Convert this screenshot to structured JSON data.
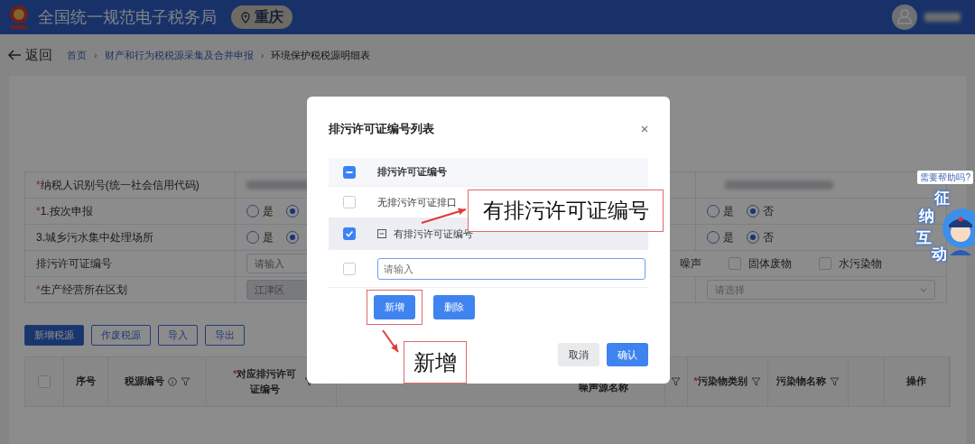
{
  "header": {
    "title": "全国统一规范电子税务局",
    "location": "重庆"
  },
  "required_mark": "*",
  "breadcrumb": {
    "back": "返回",
    "separator": "›",
    "items": [
      {
        "label": "首页",
        "current": false
      },
      {
        "label": "财产和行为税税源采集及合并申报",
        "current": false
      },
      {
        "label": "环境保护税税源明细表",
        "current": true
      }
    ]
  },
  "form": {
    "rows": [
      {
        "label": "纳税人识别号(统一社会信用代码)",
        "required": true,
        "left": {
          "kind": "redacted"
        },
        "right": {
          "kind": "redacted"
        }
      },
      {
        "label": "1.按次申报",
        "required": true,
        "left": {
          "kind": "radio",
          "options": [
            {
              "label": "是",
              "selected": false
            },
            {
              "selected": true
            }
          ]
        },
        "right": {
          "kind": "radio",
          "options": [
            {
              "label": "是",
              "selected": false
            },
            {
              "label": "否",
              "selected": true
            }
          ]
        }
      },
      {
        "label": "3.城乡污水集中处理场所",
        "required": false,
        "left": {
          "kind": "radio",
          "options": [
            {
              "label": "是",
              "selected": false
            },
            {
              "selected": true
            }
          ]
        },
        "right": {
          "kind": "radio",
          "options": [
            {
              "label": "是",
              "selected": false
            },
            {
              "label": "否",
              "selected": true
            }
          ]
        }
      },
      {
        "label": "排污许可证编号",
        "required": false,
        "left": {
          "kind": "input",
          "placeholder": "请输入",
          "disabled": false
        },
        "right": {
          "kind": "checks",
          "lead": "噪声",
          "options": [
            {
              "label": "固体废物",
              "checked": false
            },
            {
              "label": "水污染物",
              "checked": false
            }
          ]
        }
      },
      {
        "label": "生产经营所在区划",
        "required": true,
        "left": {
          "kind": "input",
          "placeholder": "江津区",
          "disabled": true
        },
        "right": {
          "kind": "select",
          "placeholder": "请选择"
        }
      }
    ]
  },
  "toolbar": [
    {
      "label": "新增税源",
      "primary": true
    },
    {
      "label": "作废税源",
      "primary": false
    },
    {
      "label": "导入",
      "primary": false
    },
    {
      "label": "导出",
      "primary": false
    }
  ],
  "table": {
    "columns_left": [
      {
        "kind": "checkbox",
        "checked": false
      },
      {
        "kind": "text",
        "label": "序号"
      },
      {
        "kind": "text",
        "label": "税源编号",
        "info": true,
        "filter": true
      },
      {
        "kind": "text",
        "label": "对应排污许可证编号",
        "required": true,
        "filter": true
      }
    ],
    "middle_label": "噪声源名称",
    "columns_right": [
      {
        "kind": "filter"
      },
      {
        "kind": "text",
        "label": "污染物类别",
        "required": true,
        "filter": true
      },
      {
        "kind": "text",
        "label": "污染物名称",
        "filter": true
      },
      {
        "kind": "blank"
      },
      {
        "kind": "text",
        "label": "操作"
      }
    ]
  },
  "modal": {
    "title": "排污许可证编号列表",
    "header": {
      "label": "排污许可证编号",
      "indeterminate": true
    },
    "rows": [
      {
        "kind": "text",
        "label": "无排污许可证排口",
        "checked": false,
        "selected": false
      },
      {
        "kind": "group",
        "label": "有排污许可证编号",
        "checked": true,
        "selected": true,
        "expanded": true
      },
      {
        "kind": "input",
        "placeholder": "请输入",
        "checked": false,
        "selected": false
      }
    ],
    "actions": [
      {
        "label": "新增",
        "highlighted": true
      },
      {
        "label": "删除",
        "highlighted": false
      }
    ],
    "footer": [
      {
        "label": "取消",
        "primary": false
      },
      {
        "label": "确认",
        "primary": true
      }
    ]
  },
  "annotations": [
    {
      "text": "有排污许可证编号"
    },
    {
      "text": "新增"
    }
  ],
  "help": {
    "tooltip": "需要帮助吗?",
    "chars": [
      "征",
      "纳",
      "互",
      "动"
    ]
  }
}
